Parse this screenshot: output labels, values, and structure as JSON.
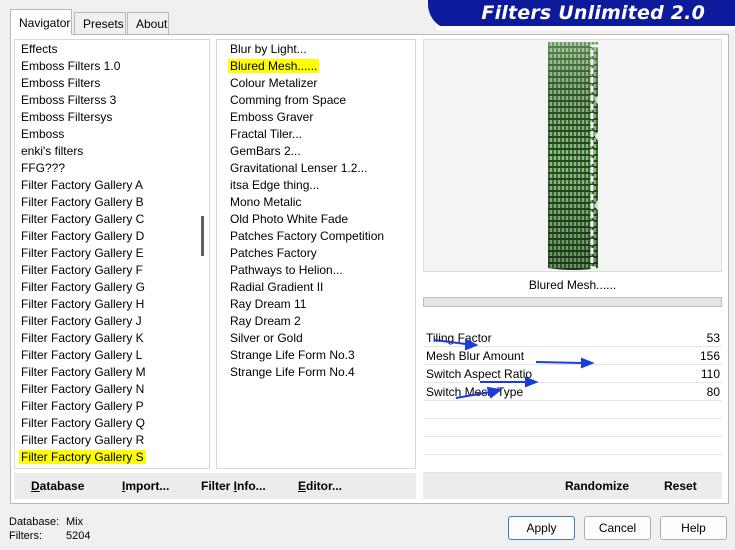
{
  "tabs": [
    "Navigator",
    "Presets",
    "About"
  ],
  "title": "Filters Unlimited 2.0",
  "categories": [
    "Effects",
    "Emboss Filters 1.0",
    "Emboss Filters",
    "Emboss Filterss 3",
    "Emboss Filtersys",
    "Emboss",
    "enki's filters",
    "FFG???",
    "Filter Factory Gallery A",
    "Filter Factory Gallery B",
    "Filter Factory Gallery C",
    "Filter Factory Gallery D",
    "Filter Factory Gallery E",
    "Filter Factory Gallery F",
    "Filter Factory Gallery G",
    "Filter Factory Gallery H",
    "Filter Factory Gallery J",
    "Filter Factory Gallery K",
    "Filter Factory Gallery L",
    "Filter Factory Gallery M",
    "Filter Factory Gallery N",
    "Filter Factory Gallery P",
    "Filter Factory Gallery Q",
    "Filter Factory Gallery R",
    "Filter Factory Gallery S"
  ],
  "selected_category": "Filter Factory Gallery S",
  "filters": [
    "Blur by Light...",
    "Blured Mesh......",
    "Colour Metalizer",
    "Comming from Space",
    "Emboss Graver",
    "Fractal Tiler...",
    "GemBars 2...",
    "Gravitational Lenser 1.2...",
    "itsa Edge thing...",
    "Mono Metalic",
    "Old Photo White Fade",
    "Patches Factory Competition",
    "Patches Factory",
    "Pathways to Helion...",
    "Radial Gradient II",
    "Ray Dream 11",
    "Ray Dream 2",
    "Silver or Gold",
    "Strange Life Form No.3",
    "Strange Life Form No.4"
  ],
  "selected_filter": "Blured Mesh......",
  "preview_caption": "Blured Mesh......",
  "params": [
    {
      "label": "Tiling Factor",
      "value": "53"
    },
    {
      "label": "Mesh Blur Amount",
      "value": "156"
    },
    {
      "label": "Switch Aspect Ratio",
      "value": "110"
    },
    {
      "label": "Switch Mesh Type",
      "value": "80"
    }
  ],
  "left_buttons": [
    {
      "u": "D",
      "rest": "atabase"
    },
    {
      "u": "I",
      "rest": "mport..."
    },
    {
      "u": "",
      "rest": "Filter ",
      "u2": "I",
      "rest2": "nfo..."
    },
    {
      "u": "E",
      "rest": "ditor..."
    }
  ],
  "randomize_label": "Randomize",
  "reset_label": "Reset",
  "status": {
    "db_label": "Database:",
    "db_value": "Mix",
    "filters_label": "Filters:",
    "filters_value": "5204"
  },
  "apply_label": "Apply",
  "cancel_label": "Cancel",
  "help_label": "Help",
  "colors": {
    "banner": "#0d1a9c",
    "highlight": "#ffff00",
    "arrow": "#1a3be0",
    "preview_green": "#5f8f55"
  }
}
